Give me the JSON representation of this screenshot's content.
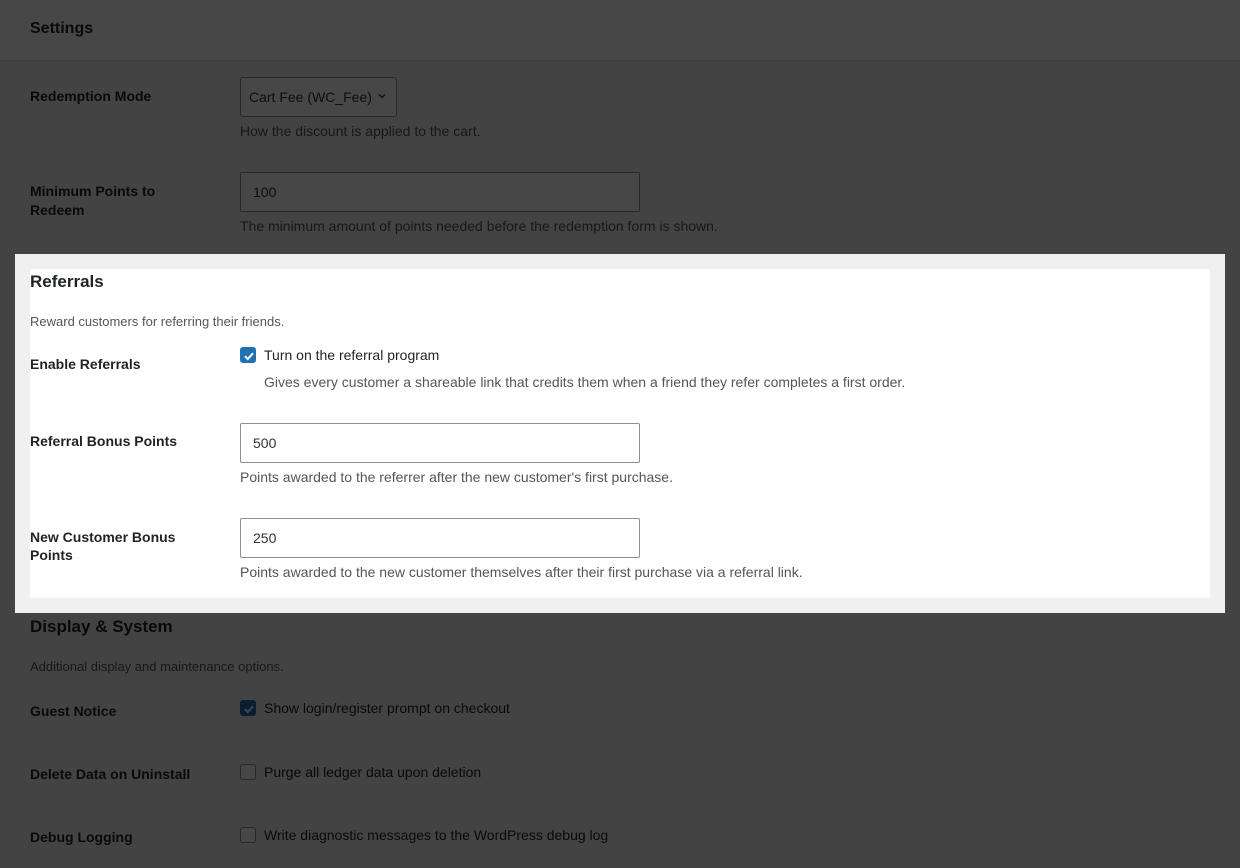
{
  "header": {
    "title": "Settings"
  },
  "redemption": {
    "mode_label": "Redemption Mode",
    "mode_value": "Cart Fee (WC_Fee)",
    "mode_desc": "How the discount is applied to the cart.",
    "min_label_line1": "Minimum Points to",
    "min_label_line2": "Redeem",
    "min_value": "100",
    "min_desc": "The minimum amount of points needed before the redemption form is shown."
  },
  "referrals": {
    "title": "Referrals",
    "desc": "Reward customers for referring their friends.",
    "enable_label": "Enable Referrals",
    "enable_checkbox_label": "Turn on the referral program",
    "enable_checked": true,
    "enable_desc": "Gives every customer a shareable link that credits them when a friend they refer completes a first order.",
    "bonus_label": "Referral Bonus Points",
    "bonus_value": "500",
    "bonus_desc": "Points awarded to the referrer after the new customer's first purchase.",
    "new_label_line1": "New Customer Bonus",
    "new_label_line2": "Points",
    "new_value": "250",
    "new_desc": "Points awarded to the new customer themselves after their first purchase via a referral link."
  },
  "display": {
    "title": "Display & System",
    "desc": "Additional display and maintenance options.",
    "guest_label": "Guest Notice",
    "guest_checkbox_label": "Show login/register prompt on checkout",
    "guest_checked": true,
    "delete_label": "Delete Data on Uninstall",
    "delete_checkbox_label": "Purge all ledger data upon deletion",
    "delete_checked": false,
    "debug_label": "Debug Logging",
    "debug_checkbox_label": "Write diagnostic messages to the WordPress debug log",
    "debug_checked": false
  },
  "colors": {
    "accent": "#2271b1",
    "background": "#f0f0f1",
    "text": "#1d2327"
  }
}
